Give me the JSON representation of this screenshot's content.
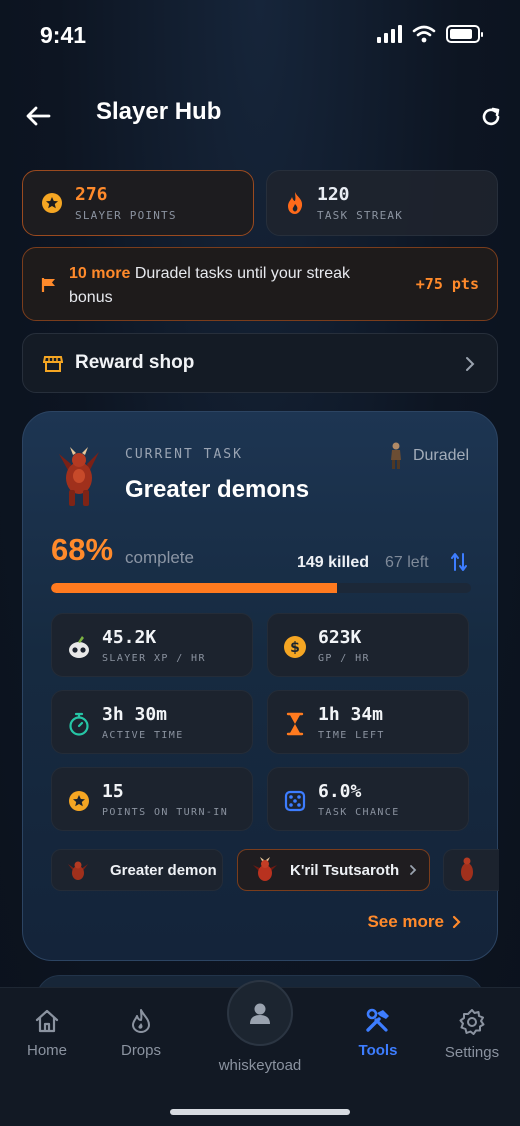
{
  "status_bar": {
    "time": "9:41"
  },
  "header": {
    "title": "Slayer Hub"
  },
  "stats": {
    "slayer_points": {
      "value": "276",
      "label": "SLAYER POINTS"
    },
    "task_streak": {
      "value": "120",
      "label": "TASK STREAK"
    }
  },
  "streak_banner": {
    "highlight": "10 more",
    "text": " Duradel tasks until your streak bonus",
    "points": "+75 pts"
  },
  "reward_shop": {
    "label": "Reward shop"
  },
  "task": {
    "label": "CURRENT TASK",
    "monster": "Greater demons",
    "master": "Duradel",
    "percent_text": "68%",
    "percent_label": "complete",
    "progress": 0.68,
    "killed": "149 killed",
    "left": "67 left",
    "tiles": [
      {
        "value": "45.2K",
        "label": "SLAYER XP / HR"
      },
      {
        "value": "623K",
        "label": "GP / HR"
      },
      {
        "value": "3h 30m",
        "label": "ACTIVE TIME"
      },
      {
        "value": "1h 34m",
        "label": "TIME LEFT"
      },
      {
        "value": "15",
        "label": "POINTS ON TURN-IN"
      },
      {
        "value": "6.0%",
        "label": "TASK CHANCE"
      }
    ],
    "variants": [
      "Greater demon",
      "K'ril Tsutsaroth"
    ],
    "see_more": "See more"
  },
  "tabs": [
    {
      "label": "Home",
      "icon": "home-icon"
    },
    {
      "label": "Drops",
      "icon": "drop-icon"
    },
    {
      "label": "Tools",
      "icon": "tools-icon"
    },
    {
      "label": "Settings",
      "icon": "gear-icon"
    }
  ],
  "profile": {
    "username": "whiskeytoad"
  },
  "colors": {
    "accent": "#ff8a2b",
    "active_tab": "#3d7dff",
    "bg": "#0d1522"
  }
}
